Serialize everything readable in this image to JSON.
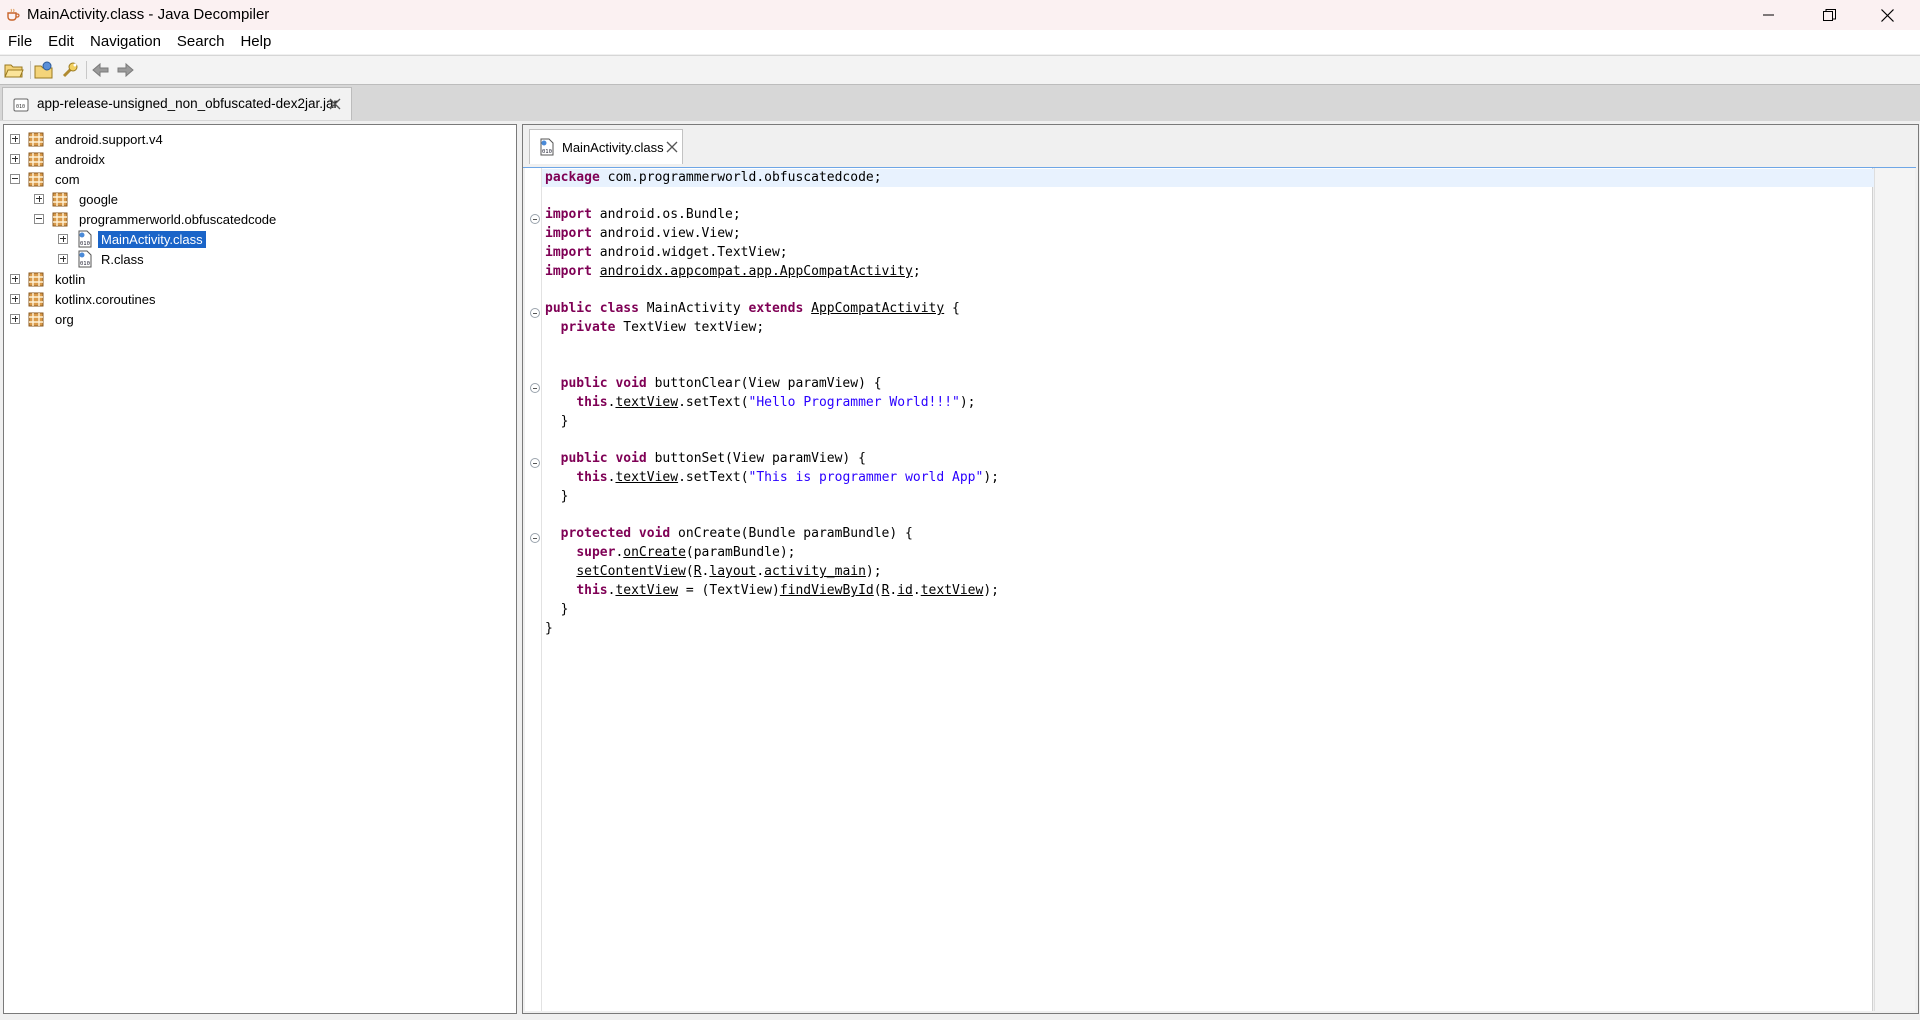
{
  "window": {
    "title": "MainActivity.class - Java Decompiler"
  },
  "menu": [
    "File",
    "Edit",
    "Navigation",
    "Search",
    "Help"
  ],
  "toolbar": {
    "buttons": [
      "open-file-icon",
      "open-type-icon",
      "search-icon",
      "back-arrow-icon",
      "forward-arrow-icon"
    ]
  },
  "jar_tab": {
    "label": "app-release-unsigned_non_obfuscated-dex2jar.jar"
  },
  "tree": {
    "items": [
      {
        "label": "android.support.v4",
        "type": "package",
        "expanded": false
      },
      {
        "label": "androidx",
        "type": "package",
        "expanded": false
      },
      {
        "label": "com",
        "type": "package",
        "expanded": true
      },
      {
        "label": "google",
        "type": "package",
        "expanded": false
      },
      {
        "label": "programmerworld.obfuscatedcode",
        "type": "package",
        "expanded": true
      },
      {
        "label": "MainActivity.class",
        "type": "class",
        "expanded": false,
        "selected": true
      },
      {
        "label": "R.class",
        "type": "class",
        "expanded": false
      },
      {
        "label": "kotlin",
        "type": "package",
        "expanded": false
      },
      {
        "label": "kotlinx.coroutines",
        "type": "package",
        "expanded": false
      },
      {
        "label": "org",
        "type": "package",
        "expanded": false
      }
    ]
  },
  "editor": {
    "tab_label": "MainActivity.class",
    "code": {
      "package_kw": "package",
      "package_name": " com.programmerworld.obfuscatedcode;",
      "import_kw": "import",
      "import1": " android.os.Bundle;",
      "import2": " android.view.View;",
      "import3": " android.widget.TextView;",
      "import4_pre": " ",
      "import4_link": "androidx.appcompat.app.AppCompatActivity",
      "import4_post": ";",
      "class_mods": "public class",
      "class_name": " MainActivity ",
      "extends_kw": "extends",
      "superclass": "AppCompatActivity",
      "class_open": " {",
      "private_kw": "private",
      "field_decl": " TextView textView;",
      "public_void": "public void",
      "protected_void": "protected void",
      "m1_sig": " buttonClear(View paramView) {",
      "this_kw": "this",
      "super_kw": "super",
      "dot": ".",
      "textView_ref": "textView",
      "setText_open": ".setText(",
      "str1": "\"Hello Programmer World!!!\"",
      "call_close": ");",
      "close_brace": "}",
      "m2_sig": " buttonSet(View paramView) {",
      "str2": "\"This is programmer world App\"",
      "m3_sig": " onCreate(Bundle paramBundle) {",
      "onCreate_ref": "onCreate",
      "super_args": "(paramBundle);",
      "setContentView_ref": "setContentView",
      "paren_open": "(",
      "R_ref": "R",
      "layout_ref": "layout",
      "activity_main_ref": "activity_main",
      "assign_cast": " = (TextView)",
      "findViewById_ref": "findViewById",
      "id_ref": "id"
    }
  }
}
